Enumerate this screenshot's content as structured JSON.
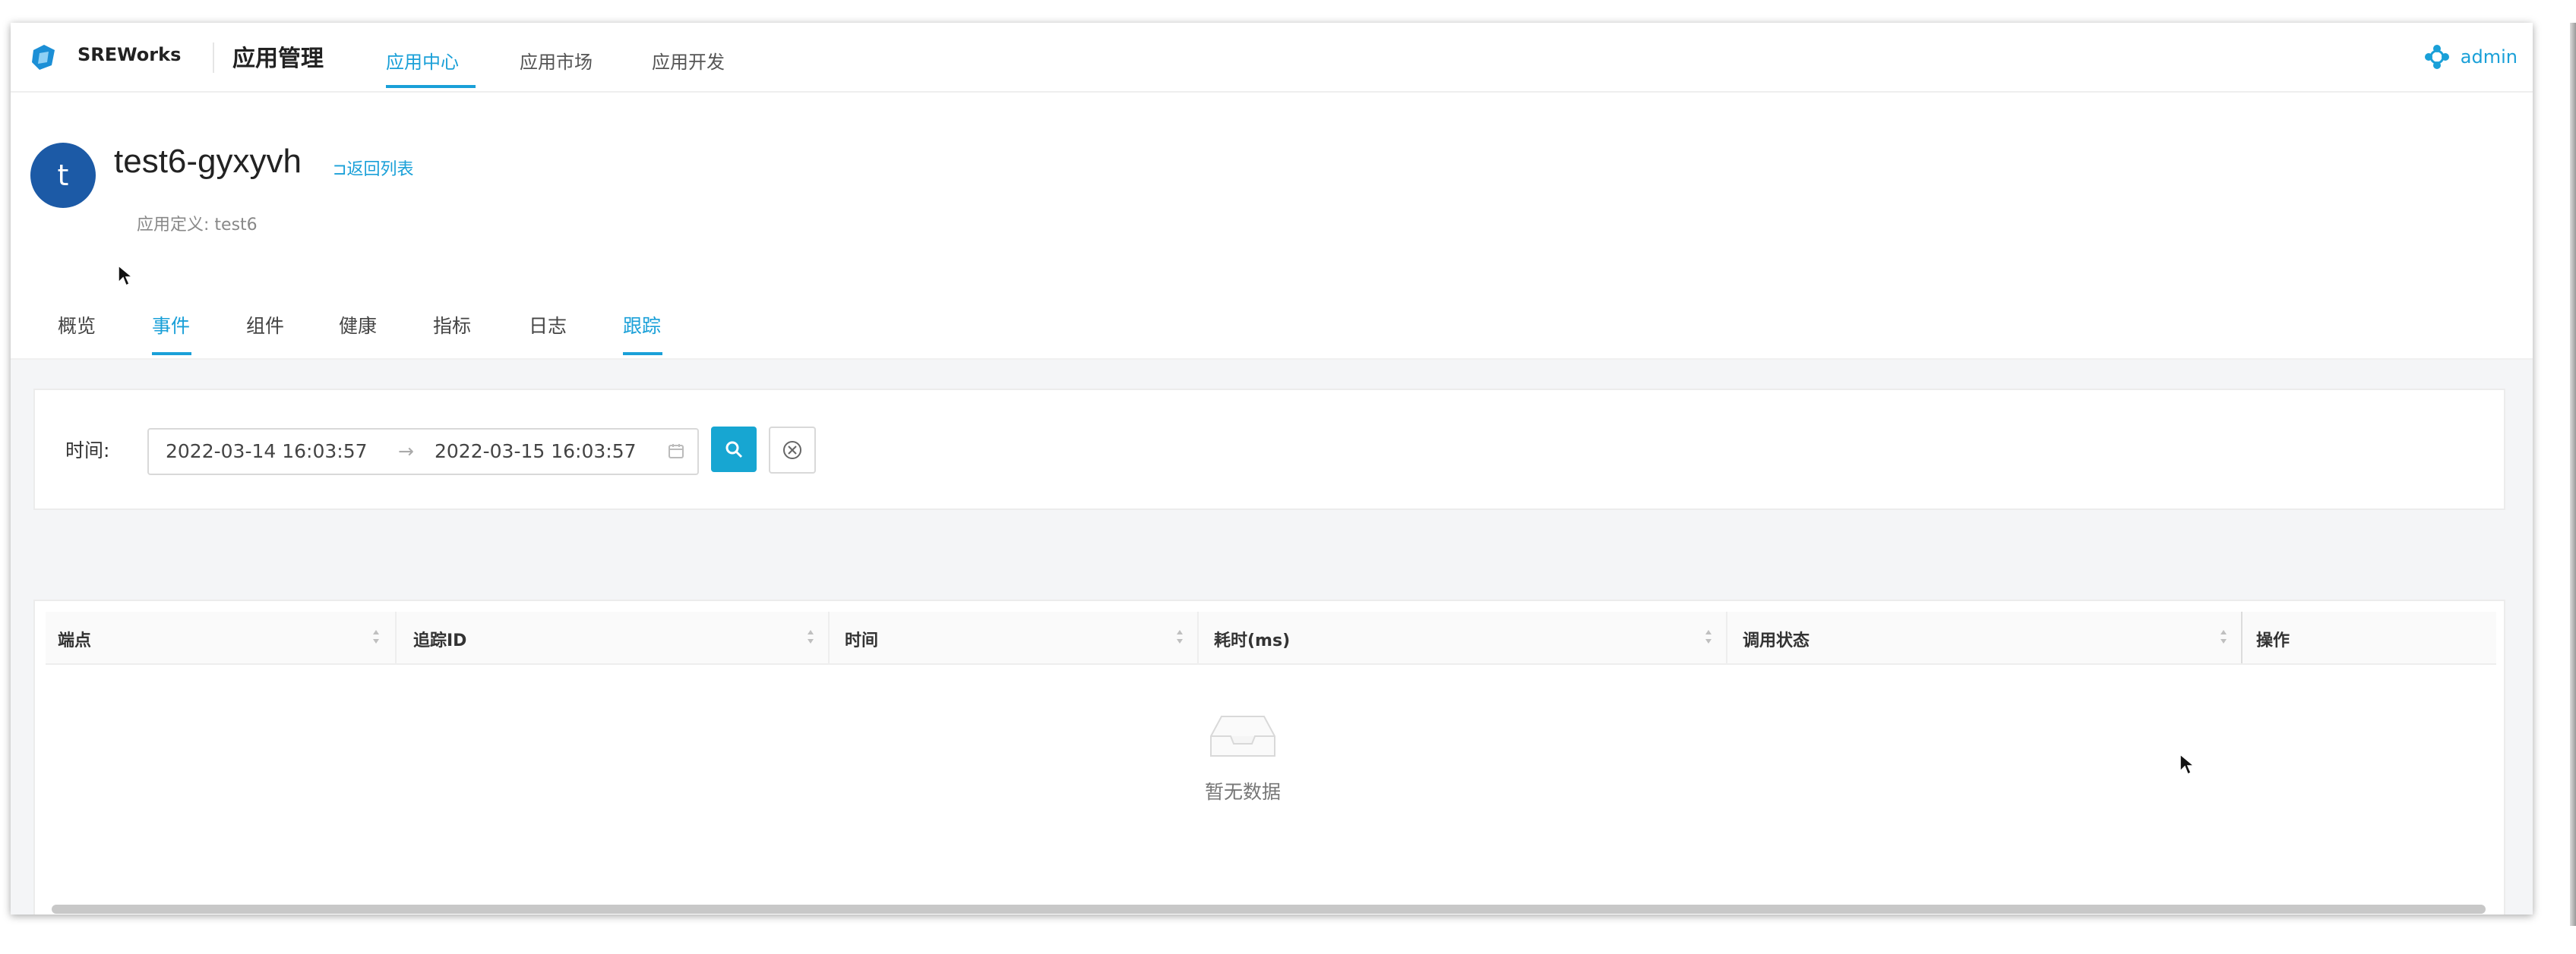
{
  "header": {
    "brand": "SREWorks",
    "app_title": "应用管理",
    "nav": [
      {
        "label": "应用中心",
        "active": true
      },
      {
        "label": "应用市场",
        "active": false
      },
      {
        "label": "应用开发",
        "active": false
      }
    ],
    "user": "admin"
  },
  "app": {
    "avatar_letter": "t",
    "name": "test6-gyxyvh",
    "back_link": "返回列表",
    "definition": "应用定义: test6"
  },
  "tabs": [
    {
      "label": "概览",
      "active": false
    },
    {
      "label": "事件",
      "active": true
    },
    {
      "label": "组件",
      "active": false
    },
    {
      "label": "健康",
      "active": false
    },
    {
      "label": "指标",
      "active": false
    },
    {
      "label": "日志",
      "active": false
    },
    {
      "label": "跟踪",
      "active": true
    }
  ],
  "filter": {
    "label": "时间:",
    "start": "2022-03-14 16:03:57",
    "arrow": "→",
    "end": "2022-03-15 16:03:57"
  },
  "table": {
    "columns": [
      "端点",
      "追踪ID",
      "时间",
      "耗时(ms)",
      "调用状态",
      "操作"
    ],
    "empty_text": "暂无数据"
  },
  "colors": {
    "accent": "#1aa0d8",
    "avatar": "#1c5aa6",
    "search_button": "#17a6d2"
  }
}
